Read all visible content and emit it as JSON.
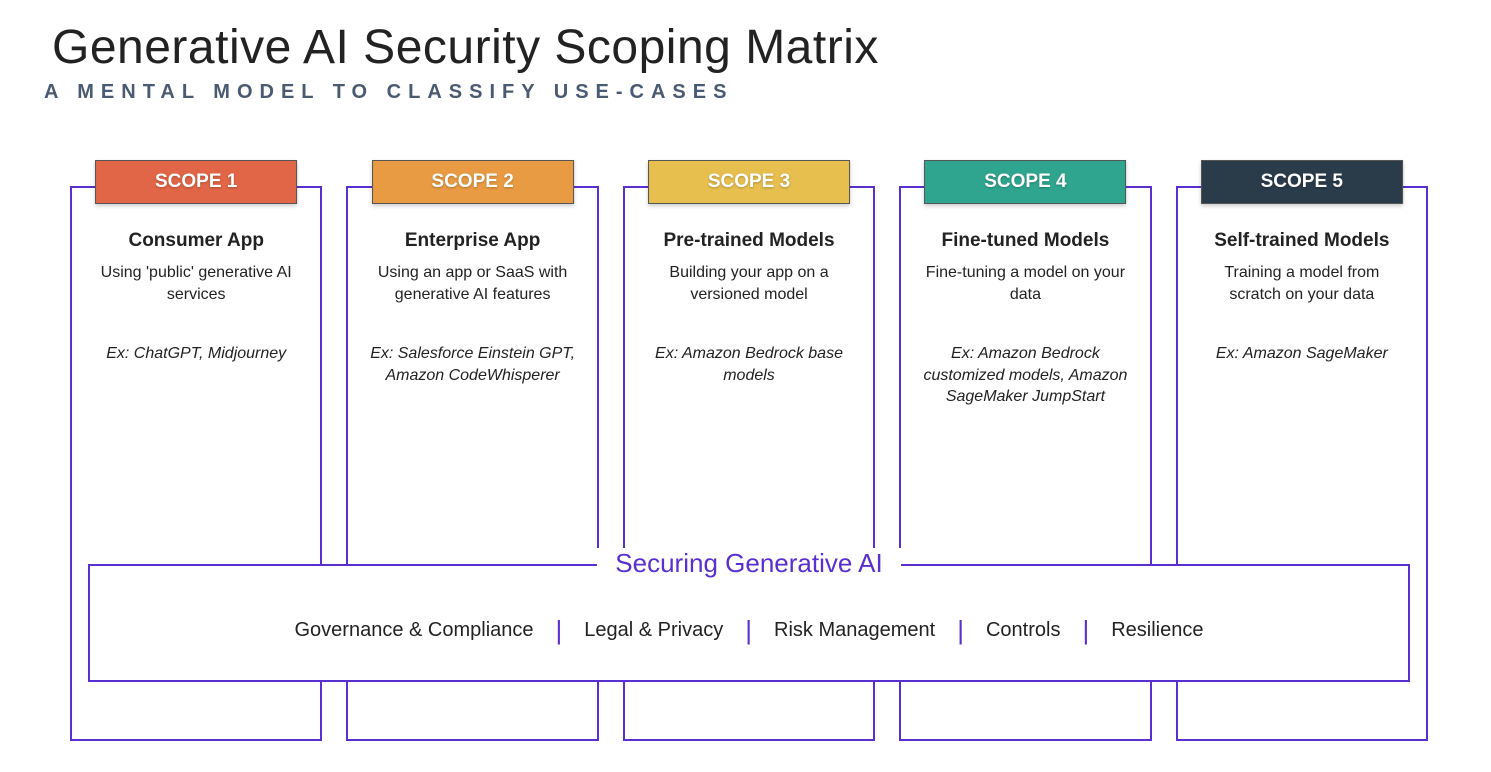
{
  "title": "Generative AI Security Scoping Matrix",
  "subtitle": "A MENTAL MODEL TO CLASSIFY USE-CASES",
  "scopes": [
    {
      "label": "SCOPE 1",
      "color": "#e06647",
      "name": "Consumer App",
      "desc": "Using 'public' generative AI services",
      "example": "Ex: ChatGPT, Midjourney"
    },
    {
      "label": "SCOPE 2",
      "color": "#e89b43",
      "name": "Enterprise App",
      "desc": "Using an app or SaaS with generative AI features",
      "example": "Ex: Salesforce Einstein GPT, Amazon CodeWhisperer"
    },
    {
      "label": "SCOPE 3",
      "color": "#e6bf4f",
      "name": "Pre-trained Models",
      "desc": "Building your app on a versioned model",
      "example": "Ex: Amazon Bedrock base models"
    },
    {
      "label": "SCOPE 4",
      "color": "#2fa58f",
      "name": "Fine-tuned Models",
      "desc": "Fine-tuning a model on your data",
      "example": "Ex: Amazon Bedrock customized models, Amazon SageMaker JumpStart"
    },
    {
      "label": "SCOPE 5",
      "color": "#2a3b4a",
      "name": "Self-trained Models",
      "desc": "Training a model from scratch on your data",
      "example": "Ex: Amazon SageMaker"
    }
  ],
  "securing": {
    "title": "Securing Generative AI",
    "pillars": [
      "Governance & Compliance",
      "Legal & Privacy",
      "Risk Management",
      "Controls",
      "Resilience"
    ]
  }
}
